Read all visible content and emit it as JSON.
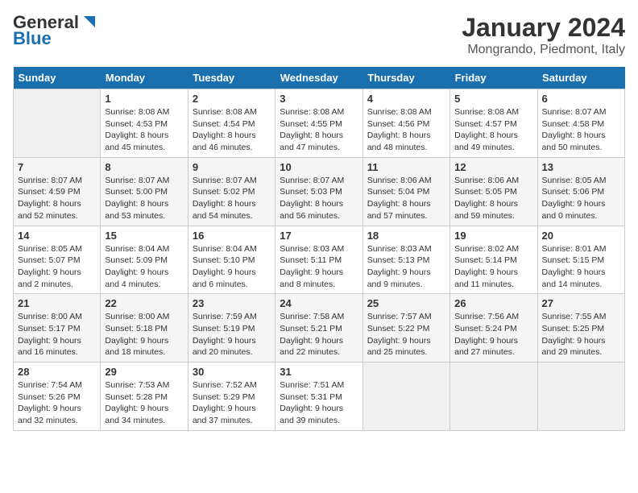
{
  "header": {
    "logo_line1": "General",
    "logo_line2": "Blue",
    "title": "January 2024",
    "subtitle": "Mongrando, Piedmont, Italy"
  },
  "calendar": {
    "days_of_week": [
      "Sunday",
      "Monday",
      "Tuesday",
      "Wednesday",
      "Thursday",
      "Friday",
      "Saturday"
    ],
    "weeks": [
      [
        {
          "day": "",
          "info": ""
        },
        {
          "day": "1",
          "info": "Sunrise: 8:08 AM\nSunset: 4:53 PM\nDaylight: 8 hours\nand 45 minutes."
        },
        {
          "day": "2",
          "info": "Sunrise: 8:08 AM\nSunset: 4:54 PM\nDaylight: 8 hours\nand 46 minutes."
        },
        {
          "day": "3",
          "info": "Sunrise: 8:08 AM\nSunset: 4:55 PM\nDaylight: 8 hours\nand 47 minutes."
        },
        {
          "day": "4",
          "info": "Sunrise: 8:08 AM\nSunset: 4:56 PM\nDaylight: 8 hours\nand 48 minutes."
        },
        {
          "day": "5",
          "info": "Sunrise: 8:08 AM\nSunset: 4:57 PM\nDaylight: 8 hours\nand 49 minutes."
        },
        {
          "day": "6",
          "info": "Sunrise: 8:07 AM\nSunset: 4:58 PM\nDaylight: 8 hours\nand 50 minutes."
        }
      ],
      [
        {
          "day": "7",
          "info": "Sunrise: 8:07 AM\nSunset: 4:59 PM\nDaylight: 8 hours\nand 52 minutes."
        },
        {
          "day": "8",
          "info": "Sunrise: 8:07 AM\nSunset: 5:00 PM\nDaylight: 8 hours\nand 53 minutes."
        },
        {
          "day": "9",
          "info": "Sunrise: 8:07 AM\nSunset: 5:02 PM\nDaylight: 8 hours\nand 54 minutes."
        },
        {
          "day": "10",
          "info": "Sunrise: 8:07 AM\nSunset: 5:03 PM\nDaylight: 8 hours\nand 56 minutes."
        },
        {
          "day": "11",
          "info": "Sunrise: 8:06 AM\nSunset: 5:04 PM\nDaylight: 8 hours\nand 57 minutes."
        },
        {
          "day": "12",
          "info": "Sunrise: 8:06 AM\nSunset: 5:05 PM\nDaylight: 8 hours\nand 59 minutes."
        },
        {
          "day": "13",
          "info": "Sunrise: 8:05 AM\nSunset: 5:06 PM\nDaylight: 9 hours\nand 0 minutes."
        }
      ],
      [
        {
          "day": "14",
          "info": "Sunrise: 8:05 AM\nSunset: 5:07 PM\nDaylight: 9 hours\nand 2 minutes."
        },
        {
          "day": "15",
          "info": "Sunrise: 8:04 AM\nSunset: 5:09 PM\nDaylight: 9 hours\nand 4 minutes."
        },
        {
          "day": "16",
          "info": "Sunrise: 8:04 AM\nSunset: 5:10 PM\nDaylight: 9 hours\nand 6 minutes."
        },
        {
          "day": "17",
          "info": "Sunrise: 8:03 AM\nSunset: 5:11 PM\nDaylight: 9 hours\nand 8 minutes."
        },
        {
          "day": "18",
          "info": "Sunrise: 8:03 AM\nSunset: 5:13 PM\nDaylight: 9 hours\nand 9 minutes."
        },
        {
          "day": "19",
          "info": "Sunrise: 8:02 AM\nSunset: 5:14 PM\nDaylight: 9 hours\nand 11 minutes."
        },
        {
          "day": "20",
          "info": "Sunrise: 8:01 AM\nSunset: 5:15 PM\nDaylight: 9 hours\nand 14 minutes."
        }
      ],
      [
        {
          "day": "21",
          "info": "Sunrise: 8:00 AM\nSunset: 5:17 PM\nDaylight: 9 hours\nand 16 minutes."
        },
        {
          "day": "22",
          "info": "Sunrise: 8:00 AM\nSunset: 5:18 PM\nDaylight: 9 hours\nand 18 minutes."
        },
        {
          "day": "23",
          "info": "Sunrise: 7:59 AM\nSunset: 5:19 PM\nDaylight: 9 hours\nand 20 minutes."
        },
        {
          "day": "24",
          "info": "Sunrise: 7:58 AM\nSunset: 5:21 PM\nDaylight: 9 hours\nand 22 minutes."
        },
        {
          "day": "25",
          "info": "Sunrise: 7:57 AM\nSunset: 5:22 PM\nDaylight: 9 hours\nand 25 minutes."
        },
        {
          "day": "26",
          "info": "Sunrise: 7:56 AM\nSunset: 5:24 PM\nDaylight: 9 hours\nand 27 minutes."
        },
        {
          "day": "27",
          "info": "Sunrise: 7:55 AM\nSunset: 5:25 PM\nDaylight: 9 hours\nand 29 minutes."
        }
      ],
      [
        {
          "day": "28",
          "info": "Sunrise: 7:54 AM\nSunset: 5:26 PM\nDaylight: 9 hours\nand 32 minutes."
        },
        {
          "day": "29",
          "info": "Sunrise: 7:53 AM\nSunset: 5:28 PM\nDaylight: 9 hours\nand 34 minutes."
        },
        {
          "day": "30",
          "info": "Sunrise: 7:52 AM\nSunset: 5:29 PM\nDaylight: 9 hours\nand 37 minutes."
        },
        {
          "day": "31",
          "info": "Sunrise: 7:51 AM\nSunset: 5:31 PM\nDaylight: 9 hours\nand 39 minutes."
        },
        {
          "day": "",
          "info": ""
        },
        {
          "day": "",
          "info": ""
        },
        {
          "day": "",
          "info": ""
        }
      ]
    ]
  }
}
